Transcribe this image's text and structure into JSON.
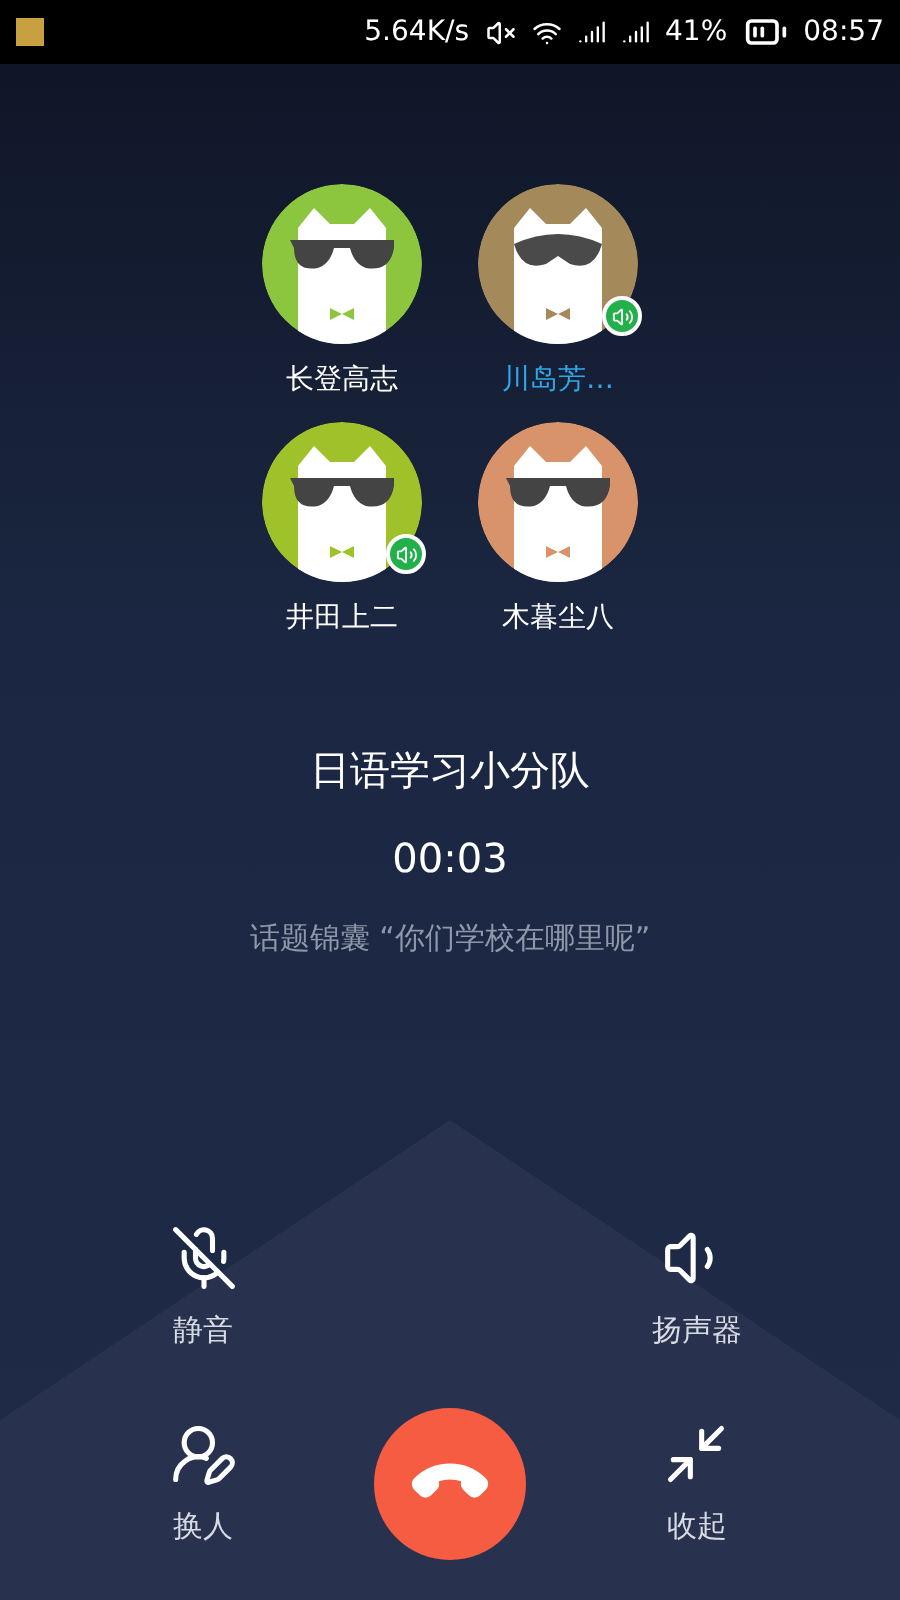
{
  "status_bar": {
    "speed": "5.64K/s",
    "battery": "41%",
    "time": "08:57"
  },
  "participants": [
    {
      "name": "长登高志",
      "color": "#8cc63f",
      "speaking": false,
      "selected": false,
      "kind": "glasses"
    },
    {
      "name": "川岛芳…",
      "color": "#a48a5a",
      "speaking": true,
      "selected": true,
      "kind": "mask"
    },
    {
      "name": "井田上二",
      "color": "#9fc22a",
      "speaking": true,
      "selected": false,
      "kind": "glasses"
    },
    {
      "name": "木暮尘八",
      "color": "#d9936a",
      "speaking": false,
      "selected": false,
      "kind": "glasses"
    }
  ],
  "group_name": "日语学习小分队",
  "timer": "00:03",
  "topic": "话题锦囊 “你们学校在哪里呢”",
  "controls": [
    {
      "label": "静音",
      "kind": "mute"
    },
    {
      "label": "扬声器",
      "kind": "speaker"
    },
    {
      "label": "换人",
      "kind": "switch"
    },
    {
      "label": "收起",
      "kind": "collapse"
    }
  ]
}
